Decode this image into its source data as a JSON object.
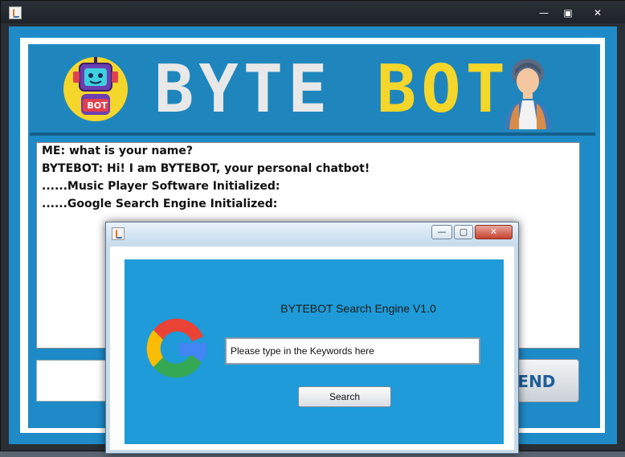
{
  "main_window": {
    "controls": {
      "minimize": "—",
      "maximize": "▣",
      "close": "✕"
    },
    "banner": {
      "title_part1": "BYTE",
      "title_part2": "BOT",
      "robot_badge": "BOT"
    },
    "chat": {
      "lines": [
        "ME: what is your name?",
        "BYTEBOT: Hi! I am BYTEBOT, your personal chatbot!",
        "......Music Player Software Initialized:",
        "......Google Search Engine Initialized:"
      ]
    },
    "input_value": "",
    "send_label": "SEND"
  },
  "dialog": {
    "controls": {
      "minimize": "—",
      "maximize": "▢",
      "close": "✕"
    },
    "title": "BYTEBOT Search Engine V1.0",
    "search": {
      "value": "Please type in the Keywords here"
    },
    "search_button": "Search"
  },
  "colors": {
    "banner_blue": "#1f86bd",
    "dialog_blue": "#1e9bd8",
    "bot_yellow": "#f5d62a",
    "bot_white": "#e8e8e8"
  }
}
